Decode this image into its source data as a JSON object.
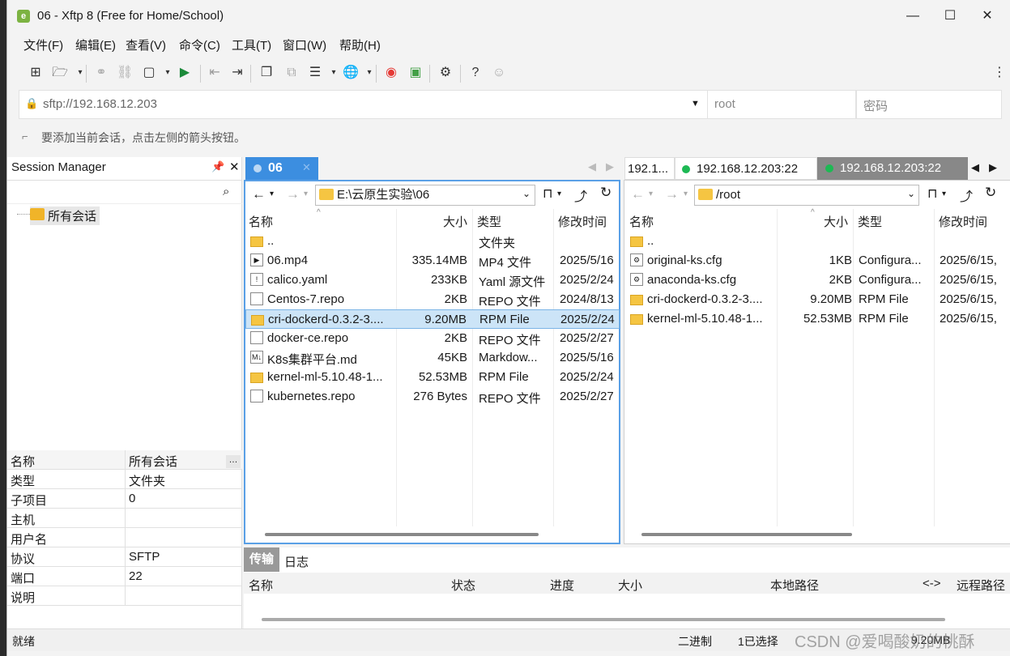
{
  "window": {
    "title": "06 - Xftp 8 (Free for Home/School)",
    "min": "—",
    "max": "☐",
    "close": "✕"
  },
  "menu": [
    "文件(F)",
    "编辑(E)",
    "查看(V)",
    "命令(C)",
    "工具(T)",
    "窗口(W)",
    "帮助(H)"
  ],
  "address": {
    "value": "sftp://192.168.12.203",
    "user_placeholder": "root",
    "password_placeholder": "密码"
  },
  "hint": "要添加当前会话，点击左侧的箭头按钮。",
  "session_manager": {
    "title": "Session Manager",
    "tree_item": "所有会话",
    "props": [
      {
        "k": "名称",
        "v": "所有会话"
      },
      {
        "k": "类型",
        "v": "文件夹"
      },
      {
        "k": "子项目",
        "v": "0"
      },
      {
        "k": "主机",
        "v": ""
      },
      {
        "k": "用户名",
        "v": ""
      },
      {
        "k": "协议",
        "v": "SFTP"
      },
      {
        "k": "端口",
        "v": "22"
      },
      {
        "k": "说明",
        "v": ""
      }
    ]
  },
  "local": {
    "tab": "06",
    "path": "E:\\云原生实验\\06",
    "headers": [
      "名称",
      "大小",
      "类型",
      "修改时间"
    ],
    "files": [
      {
        "name": "..",
        "size": "",
        "type": "文件夹",
        "date": "",
        "icon": "folder"
      },
      {
        "name": "06.mp4",
        "size": "335.14MB",
        "type": "MP4 文件",
        "date": "2025/5/16",
        "icon": "video"
      },
      {
        "name": "calico.yaml",
        "size": "233KB",
        "type": "Yaml 源文件",
        "date": "2025/2/24",
        "icon": "text"
      },
      {
        "name": "Centos-7.repo",
        "size": "2KB",
        "type": "REPO 文件",
        "date": "2024/8/13",
        "icon": "file"
      },
      {
        "name": "cri-dockerd-0.3.2-3....",
        "size": "9.20MB",
        "type": "RPM File",
        "date": "2025/2/24",
        "icon": "folder"
      },
      {
        "name": "docker-ce.repo",
        "size": "2KB",
        "type": "REPO 文件",
        "date": "2025/2/27",
        "icon": "file"
      },
      {
        "name": "K8s集群平台.md",
        "size": "45KB",
        "type": "Markdow...",
        "date": "2025/5/16",
        "icon": "md"
      },
      {
        "name": "kernel-ml-5.10.48-1...",
        "size": "52.53MB",
        "type": "RPM File",
        "date": "2025/2/24",
        "icon": "folder"
      },
      {
        "name": "kubernetes.repo",
        "size": "276 Bytes",
        "type": "REPO 文件",
        "date": "2025/2/27",
        "icon": "file"
      }
    ],
    "selected_index": 4
  },
  "remote": {
    "tabs": [
      "192.1...",
      "192.168.12.203:22",
      "192.168.12.203:22"
    ],
    "path": "/root",
    "headers": [
      "名称",
      "大小",
      "类型",
      "修改时间"
    ],
    "files": [
      {
        "name": "..",
        "size": "",
        "type": "",
        "date": "",
        "icon": "folder"
      },
      {
        "name": "original-ks.cfg",
        "size": "1KB",
        "type": "Configura...",
        "date": "2025/6/15,",
        "icon": "cfg"
      },
      {
        "name": "anaconda-ks.cfg",
        "size": "2KB",
        "type": "Configura...",
        "date": "2025/6/15,",
        "icon": "cfg"
      },
      {
        "name": "cri-dockerd-0.3.2-3....",
        "size": "9.20MB",
        "type": "RPM File",
        "date": "2025/6/15,",
        "icon": "folder"
      },
      {
        "name": "kernel-ml-5.10.48-1...",
        "size": "52.53MB",
        "type": "RPM File",
        "date": "2025/6/15,",
        "icon": "folder"
      }
    ]
  },
  "transfer": {
    "tabs": [
      "传输",
      "日志"
    ],
    "headers": [
      "名称",
      "状态",
      "进度",
      "大小",
      "本地路径",
      "<->",
      "远程路径"
    ]
  },
  "status": {
    "left": "就绪",
    "mode": "二进制",
    "selected": "1已选择",
    "size": "9.20MB",
    "watermark": "CSDN @爱喝酸奶的桃酥"
  }
}
